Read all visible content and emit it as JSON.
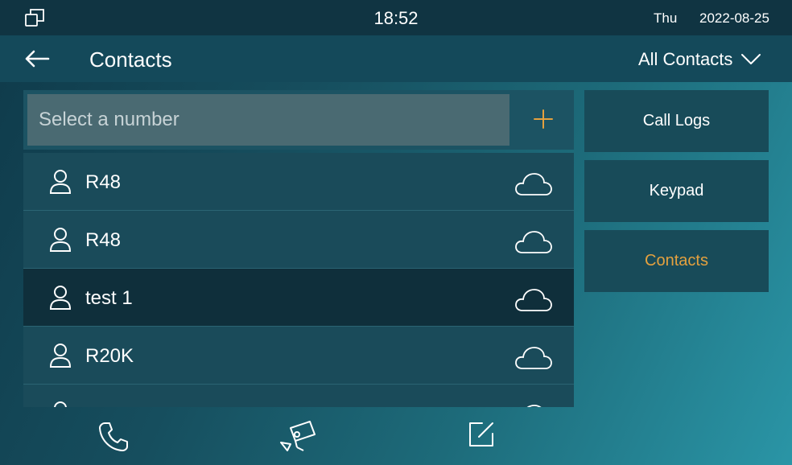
{
  "status": {
    "time": "18:52",
    "day": "Thu",
    "date": "2022-08-25"
  },
  "header": {
    "title": "Contacts",
    "filter_label": "All Contacts"
  },
  "search": {
    "placeholder": "Select a number"
  },
  "contacts": [
    {
      "name": "R48"
    },
    {
      "name": "R48"
    },
    {
      "name": "test 1"
    },
    {
      "name": "R20K"
    },
    {
      "name": ""
    }
  ],
  "side_menu": {
    "call_logs": "Call Logs",
    "keypad": "Keypad",
    "contacts": "Contacts"
  },
  "icons": {
    "window": "window-icon",
    "back": "back-arrow-icon",
    "dropdown": "chevron-down-icon",
    "add": "plus-icon",
    "person": "person-icon",
    "cloud": "cloud-icon",
    "phone": "phone-icon",
    "camera": "camera-icon",
    "edit": "edit-icon"
  },
  "colors": {
    "accent": "#e4a13f",
    "selected_row": "#0f2f3b"
  }
}
